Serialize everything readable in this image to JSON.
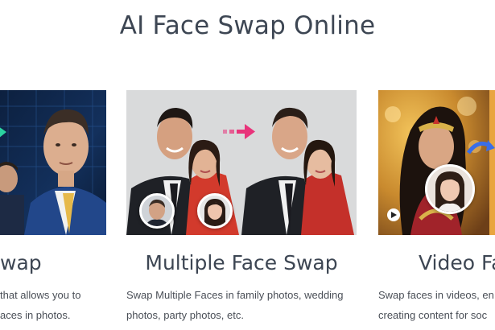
{
  "header": {
    "title": "AI Face Swap Online"
  },
  "cards": [
    {
      "title": "wap",
      "desc_lines": [
        "that allows you to",
        "aces in photos."
      ]
    },
    {
      "title": "Multiple Face Swap",
      "desc_lines": [
        "Swap Multiple Faces in family photos, wedding",
        "photos, party photos, etc."
      ]
    },
    {
      "title": "Video Fa",
      "desc_lines": [
        "Swap faces in videos, en",
        "creating content for soc"
      ]
    }
  ],
  "icons": {
    "swap_arrow": "arrow-right-icon",
    "play": "play-icon",
    "curve_arrow": "curved-arrow-icon"
  },
  "colors": {
    "title_text": "#3d4653",
    "body_text": "#4a4f57",
    "arrow_pink": "#e8337a",
    "arrow_blue": "#3a6ee8"
  }
}
